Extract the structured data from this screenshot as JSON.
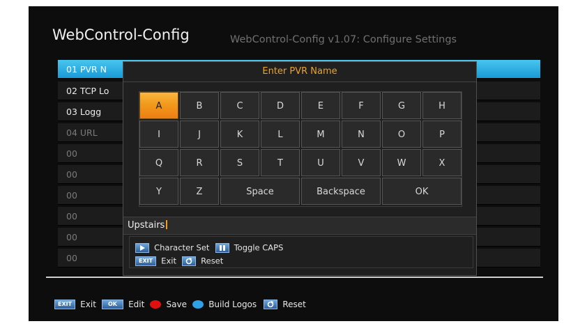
{
  "header": {
    "title": "WebControl-Config",
    "subtitle": "WebControl-Config v1.07: Configure Settings"
  },
  "list": {
    "items": [
      {
        "label": "01  PVR N",
        "state": "selected"
      },
      {
        "label": "02  TCP Lo",
        "state": "enabled"
      },
      {
        "label": "03  Logg",
        "state": "enabled"
      },
      {
        "label": "04  URL",
        "state": "disabled"
      },
      {
        "label": "00",
        "state": "disabled"
      },
      {
        "label": "00",
        "state": "disabled"
      },
      {
        "label": "00",
        "state": "disabled"
      },
      {
        "label": "00",
        "state": "disabled"
      },
      {
        "label": "00",
        "state": "disabled"
      },
      {
        "label": "00",
        "state": "disabled"
      }
    ]
  },
  "dialog": {
    "title": "Enter PVR Name",
    "keys": [
      "A",
      "B",
      "C",
      "D",
      "E",
      "F",
      "G",
      "H",
      "I",
      "J",
      "K",
      "L",
      "M",
      "N",
      "O",
      "P",
      "Q",
      "R",
      "S",
      "T",
      "U",
      "V",
      "W",
      "X",
      "Y",
      "Z",
      "Space",
      "Backspace",
      "OK"
    ],
    "active_key": "A",
    "input_value": "Upstairs",
    "hints": {
      "charset_label": "Character Set",
      "caps_label": "Toggle CAPS",
      "exit_btn": "EXIT",
      "exit_label": "Exit",
      "reset_label": "Reset"
    }
  },
  "footer": {
    "exit_btn": "EXIT",
    "exit_label": "Exit",
    "ok_btn": "OK",
    "edit_label": "Edit",
    "save_label": "Save",
    "build_logos_label": "Build Logos",
    "reset_label": "Reset"
  },
  "colors": {
    "accent_orange": "#eca32a",
    "selection_blue": "#1a99d6",
    "save_red": "#e01010",
    "build_logos_blue": "#2f9fe6"
  },
  "icons": {
    "charset": "play-triangle-icon",
    "caps": "pause-bars-icon",
    "reset": "circular-arrow-icon"
  }
}
